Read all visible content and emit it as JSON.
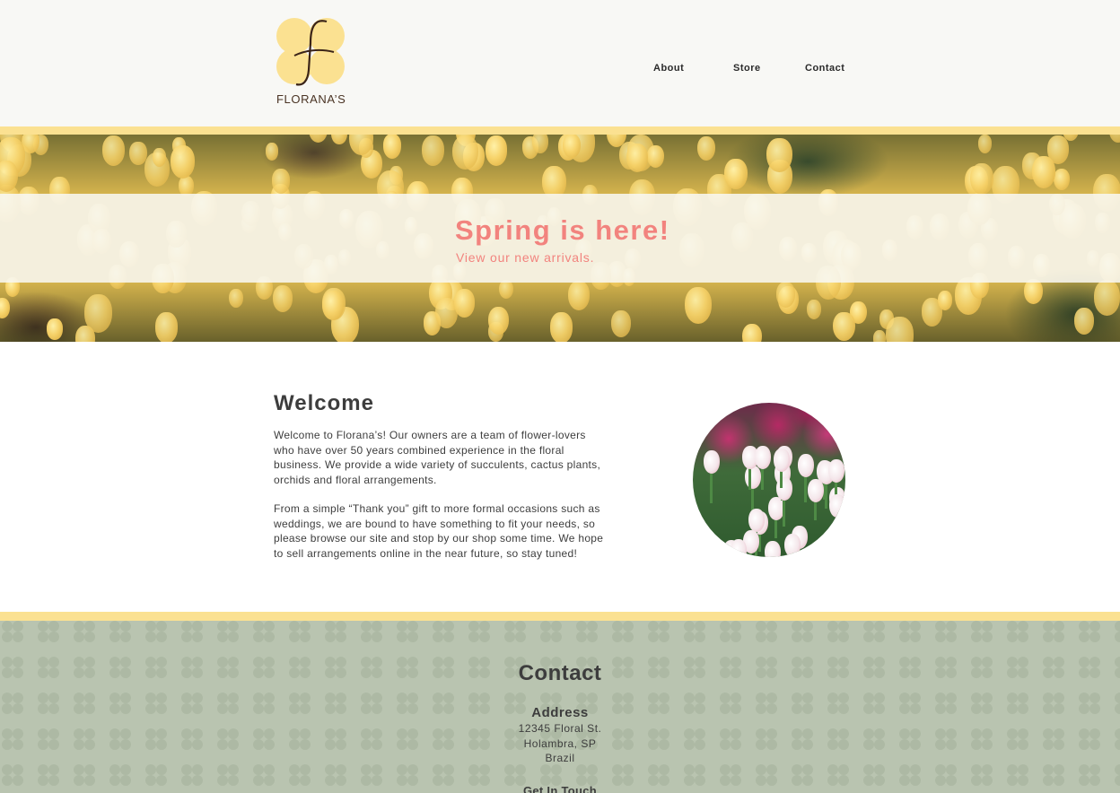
{
  "header": {
    "logo_text": "FLORANA’S",
    "nav": {
      "about": "About",
      "store": "Store",
      "contact": "Contact"
    }
  },
  "hero": {
    "title": "Spring is here!",
    "subtitle": "View our new arrivals."
  },
  "welcome": {
    "title": "Welcome",
    "paragraph_1": "Welcome to Florana’s! Our owners are a team of flower-lovers who have over 50 years combined experience in the floral business. We provide a wide variety of succulents, cactus plants, orchids and floral arrangements.",
    "paragraph_2": "From a simple “Thank you” gift to more formal occasions such as weddings, we are bound to have something to fit your needs, so please browse our site and stop by our shop some time. We hope to sell arrangements online in the near future, so stay tuned!"
  },
  "footer": {
    "title": "Contact",
    "address_heading": "Address",
    "address_line_1": "12345 Floral St.",
    "address_line_2": "Holambra, SP",
    "address_line_3": "Brazil",
    "get_in_touch": "Get In Touch"
  },
  "colors": {
    "accent_yellow": "#fbe191",
    "hero_text": "#f2837e",
    "footer_bg": "#b9c4b0",
    "text_dark": "#3d3d3d"
  }
}
